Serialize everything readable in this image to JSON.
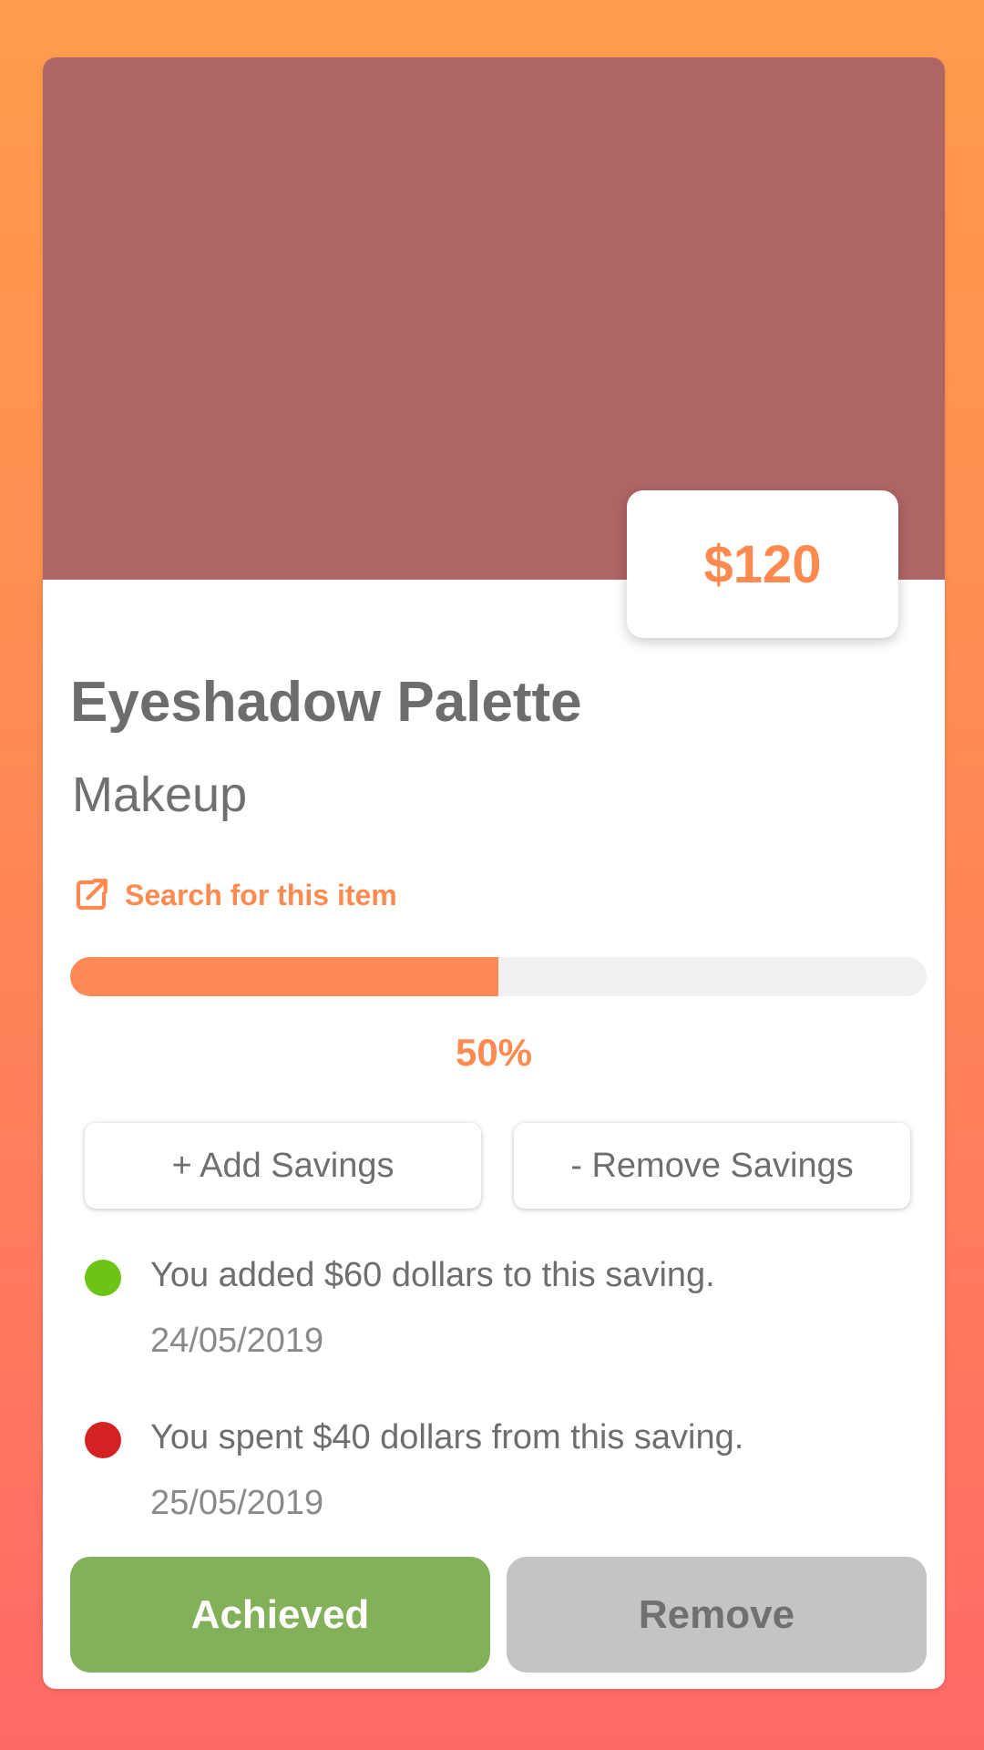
{
  "colors": {
    "accent": "#ff8a50",
    "hero": "#b06565",
    "achieved": "#82b15a",
    "remove": "#c4c4c4",
    "added_dot": "#6cc417",
    "spent_dot": "#d42222"
  },
  "item": {
    "price": "$120",
    "title": "Eyeshadow Palette",
    "category": "Makeup",
    "search_label": "Search for this item",
    "search_icon": "external-link-icon"
  },
  "progress": {
    "fraction": 0.5,
    "label": "50%"
  },
  "actions": {
    "add_savings": "+ Add Savings",
    "remove_savings": "- Remove Savings",
    "achieved": "Achieved",
    "remove": "Remove"
  },
  "history": [
    {
      "type": "added",
      "text": "You added $60 dollars to this saving.",
      "date": "24/05/2019"
    },
    {
      "type": "spent",
      "text": "You spent $40 dollars from this saving.",
      "date": "25/05/2019"
    }
  ]
}
